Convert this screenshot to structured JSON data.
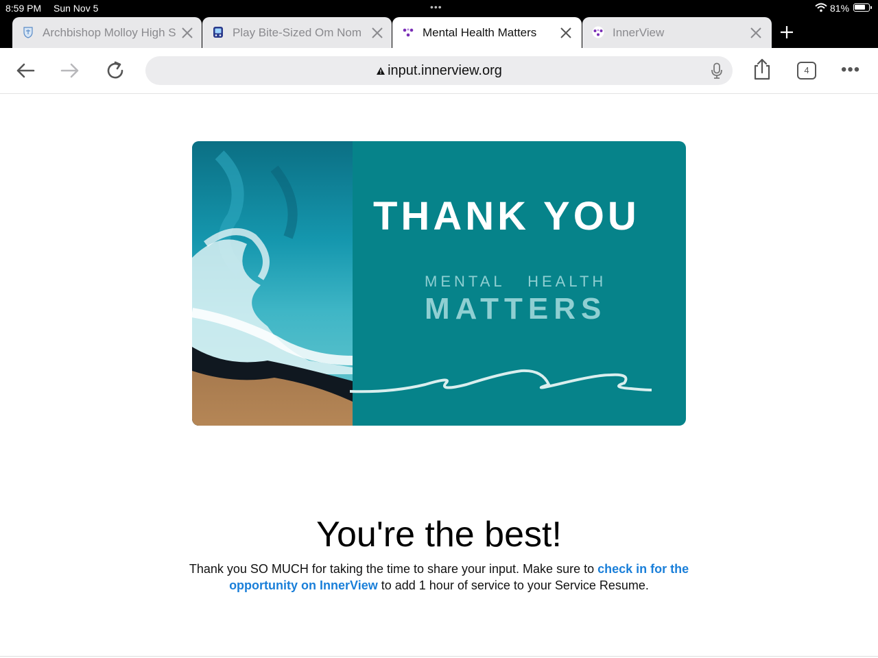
{
  "status_bar": {
    "time": "8:59 PM",
    "date": "Sun Nov 5",
    "battery_percent": "81%",
    "battery_level": 0.81
  },
  "tabs": [
    {
      "title": "Archbishop Molloy High S",
      "icon": "school-crest-icon",
      "active": false
    },
    {
      "title": "Play Bite-Sized Om Nom",
      "icon": "game-icon",
      "active": false
    },
    {
      "title": "Mental Health Matters",
      "icon": "innerview-logo-icon",
      "active": true
    },
    {
      "title": "InnerView",
      "icon": "innerview-logo-icon",
      "active": false
    }
  ],
  "toolbar": {
    "url": "input.innerview.org",
    "tab_count": "4"
  },
  "banner": {
    "thank_you": "THANK YOU",
    "mental_health": "MENTAL   HEALTH",
    "matters": "MATTERS",
    "bg_color": "#06838a"
  },
  "content": {
    "headline": "You're the best!",
    "message_before": "Thank you SO MUCH for taking the time to share your input. Make sure to ",
    "link_text": "check in for the opportunity on InnerView",
    "message_after": " to add 1 hour of service to your Service Resume.",
    "link_color": "#1a7fd9"
  }
}
